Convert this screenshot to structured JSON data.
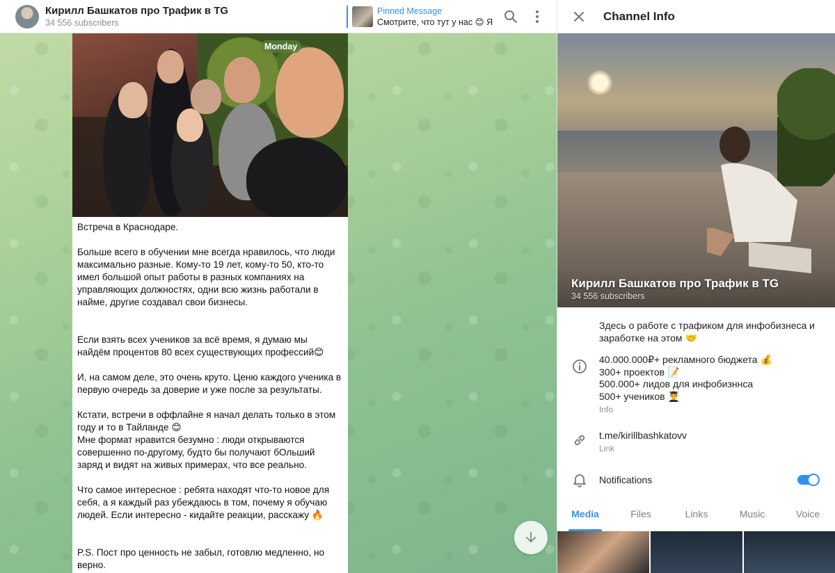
{
  "chat": {
    "title": "Кирилл Башкатов про Трафик в TG",
    "subscribers": "34 556 subscribers",
    "pinned": {
      "label": "Pinned Message",
      "text": "Смотрите, что тут у нас 😊 Я ..."
    },
    "day_badge": "Monday",
    "message": {
      "paragraphs": [
        "Встреча в Краснодаре.",
        "Больше всего в обучении  мне всегда нравилось, что люди максимально разные. Кому-то 19 лет, кому-то 50, кто-то имел большой опыт работы в разных компаниях на управляющих должностях, одни всю жизнь работали в найме, другие создавал свои бизнесы.",
        "Если взять всех учеников за всё время, я думаю мы найдём процентов 80 всех существующих профессий😊",
        "И, на самом деле, это очень круто. Ценю каждого ученика в первую очередь за доверие и уже после за результаты.",
        "Кстати, встречи в оффлайне я начал делать только в этом году и то в Тайланде 😊\nМне формат нравится безумно : люди открываются совершенно по-другому, будто бы получают бОльший заряд и видят на живых примерах, что все реально.",
        "Что самое интересное : ребята находят что-то новое для себя, а я каждый раз убеждаюсь в том, почему я обучаю людей. Если интересно - кидайте реакции, расскажу 🔥",
        "P.S. Пост про ценность не забыл, готовлю медленно, но верно."
      ]
    }
  },
  "info": {
    "header_title": "Channel Info",
    "cover_name": "Кирилл Башкатов про Трафик в TG",
    "cover_sub": "34 556 subscribers",
    "description": "Здесь о работе с трафиком для инфобизнеса и заработке на этом 🤝",
    "info_lines": [
      "40.000.000₽+ рекламного бюджета 💰",
      "300+ проектов 📝",
      "500.000+ лидов для инфобизннса",
      "500+ учеников 👨‍🎓"
    ],
    "info_label": "Info",
    "link": "t.me/kirillbashkatovv",
    "link_label": "Link",
    "notifications_label": "Notifications",
    "notifications_on": true,
    "tabs": [
      "Media",
      "Files",
      "Links",
      "Music",
      "Voice"
    ]
  },
  "colors": {
    "accent": "#3390ec",
    "header_bg": "#ffffff",
    "muted_text": "#8b8f94"
  }
}
